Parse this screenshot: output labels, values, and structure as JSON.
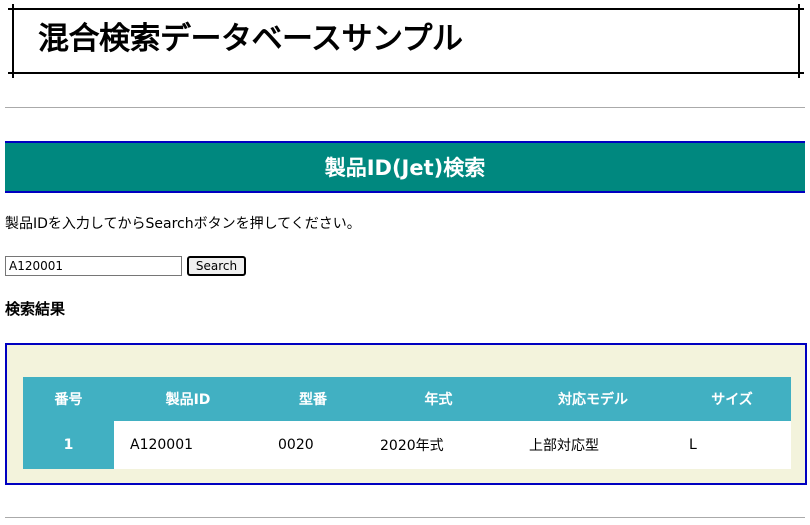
{
  "header": {
    "title": "混合検索データベースサンプル"
  },
  "section": {
    "title": "製品ID(Jet)検索"
  },
  "instructions": "製品IDを入力してからSearchボタンを押してください。",
  "search": {
    "value": "A120001",
    "button_label": "Search"
  },
  "results": {
    "heading": "検索結果",
    "columns": [
      "番号",
      "製品ID",
      "型番",
      "年式",
      "対応モデル",
      "サイズ"
    ],
    "rows": [
      [
        "1",
        "A120001",
        "0020",
        "2020年式",
        "上部対応型",
        "L"
      ]
    ]
  },
  "colors": {
    "section_bg": "#00887f",
    "section_border": "#0000c0",
    "table_header_bg": "#41b0c2",
    "results_frame_bg": "#f3f3dc"
  }
}
